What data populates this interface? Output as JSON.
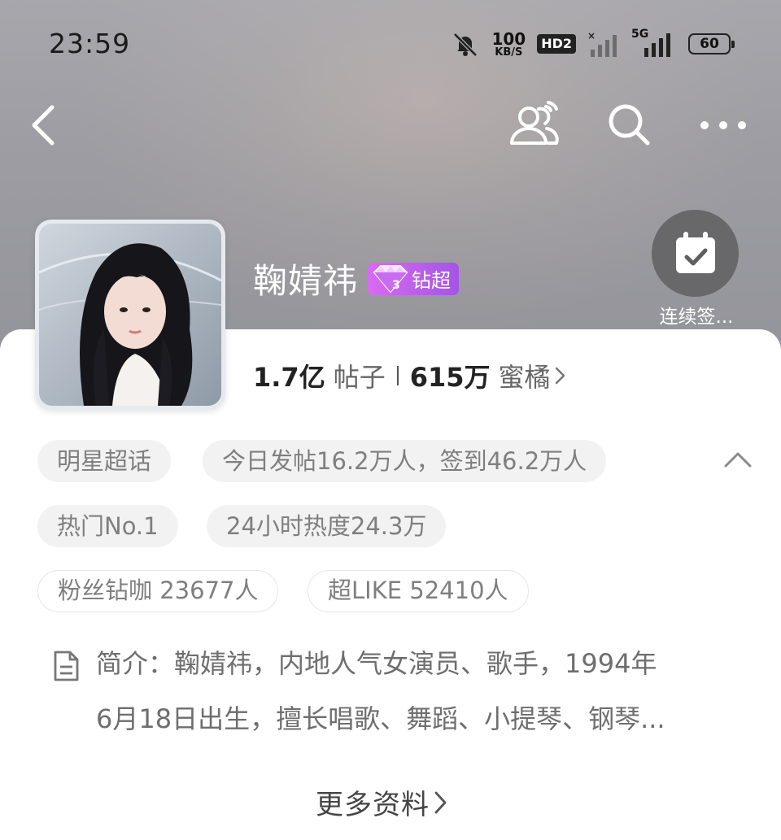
{
  "status_bar": {
    "time": "23:59",
    "net_speed_value": "100",
    "net_speed_unit": "KB/S",
    "hd_label": "HD2",
    "network_label": "5G",
    "battery": "60"
  },
  "header": {
    "title": "鞠婧祎",
    "badge_text": "钻超",
    "checkin_label": "连续签..."
  },
  "stats": {
    "posts_value": "1.7亿",
    "posts_label": "帖子",
    "fans_value": "615万",
    "fans_label": "蜜橘"
  },
  "tags": [
    "明星超话",
    "今日发帖16.2万人，签到46.2万人",
    "热门No.1",
    "24小时热度24.3万",
    "粉丝钻咖 23677人",
    "超LIKE 52410人"
  ],
  "intro": {
    "line1": "简介：鞠婧祎，内地人气女演员、歌手，1994年",
    "line2": "6月18日出生，擅长唱歌、舞蹈、小提琴、钢琴..."
  },
  "more_info_label": "更多资料",
  "icons": {
    "back": "chevron-left-icon",
    "people": "people-icon",
    "search": "search-icon",
    "more": "more-icon",
    "checkin": "calendar-check-icon",
    "collapse": "chevron-up-icon",
    "intro": "document-icon"
  },
  "colors": {
    "badge_gradient_start": "#d86bf2",
    "badge_gradient_end": "#a454e6",
    "tag_bg": "#f2f2f2",
    "tag_text": "#7f7f7f"
  }
}
